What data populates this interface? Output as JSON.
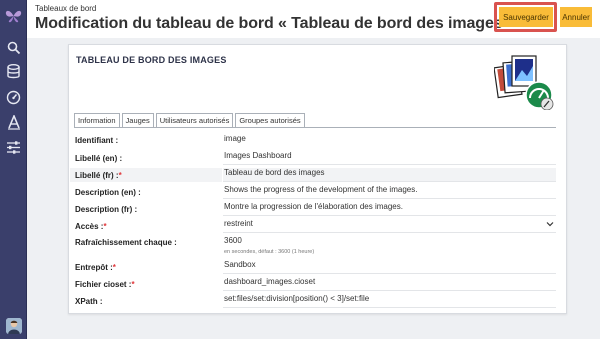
{
  "header": {
    "breadcrumb": "Tableaux de bord",
    "title": "Modification du tableau de bord « Tableau de bord des images »",
    "save_label": "Sauvegarder",
    "cancel_label": "Annuler"
  },
  "sidebar": {
    "items": [
      {
        "icon": "butterfly-logo-icon"
      },
      {
        "icon": "search-icon"
      },
      {
        "icon": "database-icon"
      },
      {
        "icon": "dashboard-gauge-icon"
      },
      {
        "icon": "typography-icon"
      },
      {
        "icon": "sliders-icon"
      }
    ],
    "avatar": "user-avatar"
  },
  "card": {
    "title": "Tableau de bord des images",
    "tabs": [
      {
        "label": "Information"
      },
      {
        "label": "Jauges"
      },
      {
        "label": "Utilisateurs autorisés"
      },
      {
        "label": "Groupes autorisés"
      }
    ],
    "active_tab": "Information"
  },
  "fields": [
    {
      "label": "Identifiant :",
      "required": false,
      "value": "image"
    },
    {
      "label": "Libellé (en) :",
      "required": false,
      "value": "Images Dashboard"
    },
    {
      "label": "Libellé (fr) :",
      "required": true,
      "value": "Tableau de bord des images"
    },
    {
      "label": "Description (en) :",
      "required": false,
      "value": "Shows the progress of the development of the images."
    },
    {
      "label": "Description (fr) :",
      "required": false,
      "value": "Montre la progression de l'élaboration des images."
    },
    {
      "label": "Accès :",
      "required": true,
      "value": "restreint"
    },
    {
      "label": "Rafraîchissement chaque :",
      "required": false,
      "value": "3600",
      "hint": "en secondes, défaut : 3600 (1 heure)"
    },
    {
      "label": "Entrepôt :",
      "required": true,
      "value": "Sandbox"
    },
    {
      "label": "Fichier cioset :",
      "required": true,
      "value": "dashboard_images.cioset"
    },
    {
      "label": "XPath :",
      "required": false,
      "value": "set:files/set:division[position() < 3]/set:file"
    }
  ],
  "required_marker": "*",
  "colors": {
    "sidebar": "#3a3f6b",
    "button": "#f9bc38",
    "highlight": "#d9534f",
    "required": "#e0373b"
  }
}
